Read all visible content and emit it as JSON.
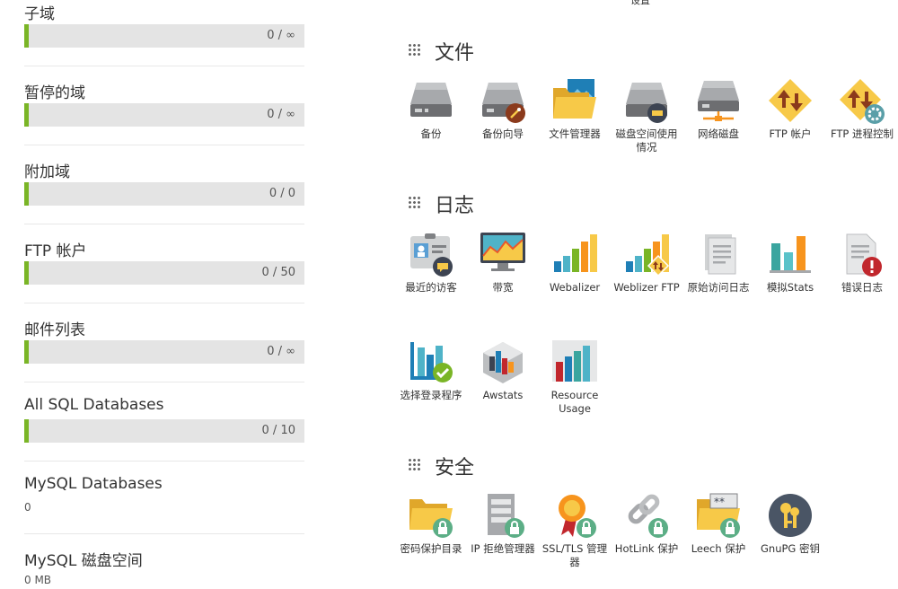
{
  "stats": [
    {
      "label": "子域",
      "value": "0 / ∞",
      "percent": 0
    },
    {
      "label": "暂停的域",
      "value": "0 / ∞",
      "percent": 0
    },
    {
      "label": "附加域",
      "value": "0 / 0",
      "percent": 0
    },
    {
      "label": "FTP 帐户",
      "value": "0 / 50",
      "percent": 0
    },
    {
      "label": "邮件列表",
      "value": "0 / ∞",
      "percent": 0
    },
    {
      "label": "All SQL Databases",
      "value": "0 / 10",
      "percent": 0
    },
    {
      "label": "MySQL Databases",
      "value": "0"
    },
    {
      "label": "MySQL 磁盘空间",
      "value": "0 MB"
    }
  ],
  "top_cut_text": "设置",
  "sections": {
    "files": {
      "title": "文件",
      "items": [
        {
          "label": "备份",
          "icon": "drive-icon"
        },
        {
          "label": "备份向导",
          "icon": "backup-wizard-icon"
        },
        {
          "label": "文件管理器",
          "icon": "file-manager-icon"
        },
        {
          "label": "磁盘空间使用情况",
          "icon": "disk-usage-icon"
        },
        {
          "label": "网络磁盘",
          "icon": "network-drive-icon"
        },
        {
          "label": "FTP 帐户",
          "icon": "ftp-accounts-icon"
        },
        {
          "label": "FTP 进程控制",
          "icon": "ftp-session-control-icon"
        }
      ]
    },
    "logs": {
      "title": "日志",
      "items": [
        {
          "label": "最近的访客",
          "icon": "visitors-icon"
        },
        {
          "label": "带宽",
          "icon": "bandwidth-icon"
        },
        {
          "label": "Webalizer",
          "icon": "webalizer-icon"
        },
        {
          "label": "Weblizer FTP",
          "icon": "webalizer-ftp-icon"
        },
        {
          "label": "原始访问日志",
          "icon": "raw-access-icon"
        },
        {
          "label": "模拟Stats",
          "icon": "analog-stats-icon"
        },
        {
          "label": "错误日志",
          "icon": "error-log-icon"
        },
        {
          "label": "选择登录程序",
          "icon": "choose-log-programs-icon"
        },
        {
          "label": "Awstats",
          "icon": "awstats-icon"
        },
        {
          "label": "Resource Usage",
          "icon": "resource-usage-icon"
        }
      ]
    },
    "security": {
      "title": "安全",
      "items": [
        {
          "label": "密码保护目录",
          "icon": "password-directory-icon"
        },
        {
          "label": "IP 拒绝管理器",
          "icon": "ip-blocker-icon"
        },
        {
          "label": "SSL/TLS 管理器",
          "icon": "ssl-icon"
        },
        {
          "label": "HotLink 保护",
          "icon": "hotlink-icon"
        },
        {
          "label": "Leech 保护",
          "icon": "leech-icon"
        },
        {
          "label": "GnuPG 密钥",
          "icon": "gnupg-icon"
        }
      ]
    }
  },
  "colors": {
    "accent": "#7ab526",
    "bar_bg": "#e4e4e4",
    "folder": "#f7c948",
    "lock": "#5cae86"
  }
}
